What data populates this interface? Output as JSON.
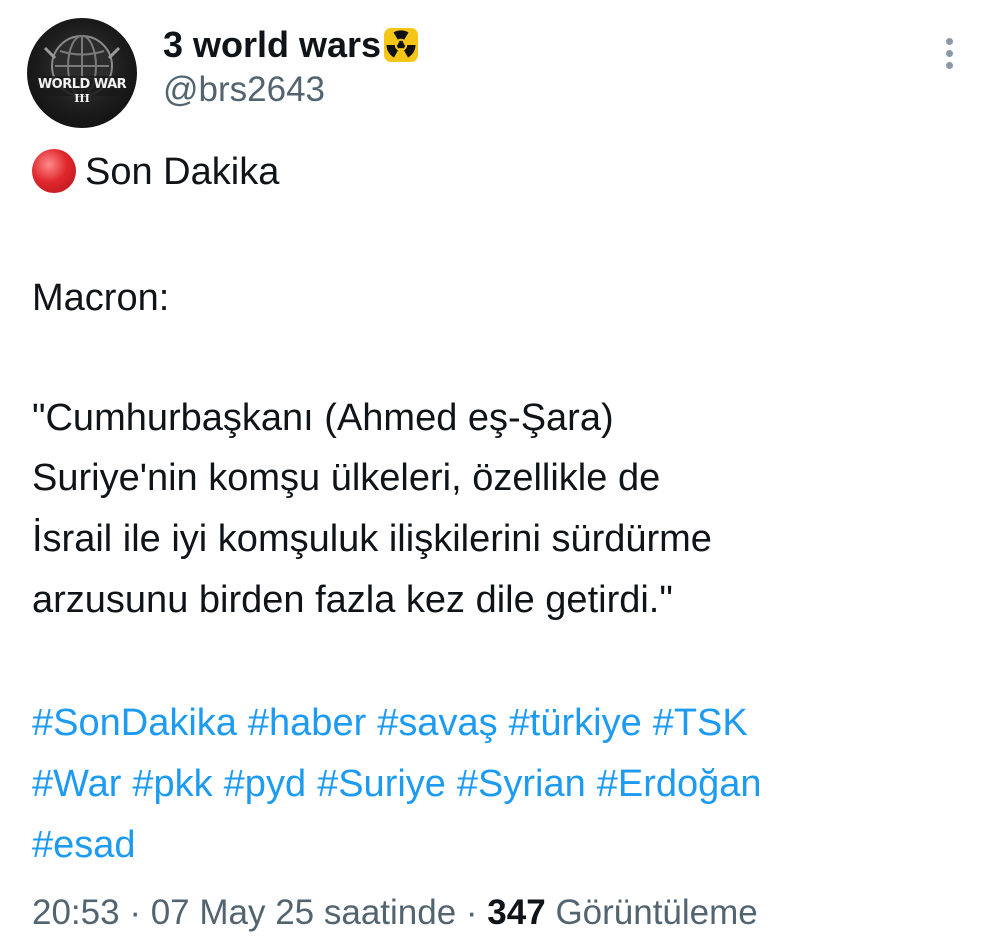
{
  "header": {
    "display_name": "3 world wars",
    "name_emoji_icon": "radioactive-icon",
    "handle": "@brs2643",
    "avatar": {
      "line1": "WORLD WAR",
      "line2": "III"
    },
    "more_icon": "more-vertical-icon"
  },
  "body": {
    "line1_icon": "red-circle-icon",
    "line1": "Son Dakika",
    "line2": "Macron:",
    "quote_lines": [
      "\"Cumhurbaşkanı (Ahmed eş-Şara)",
      "Suriye'nin komşu ülkeleri, özellikle de",
      "İsrail ile iyi komşuluk ilişkilerini sürdürme",
      "arzusunu birden fazla kez dile getirdi.\""
    ]
  },
  "hashtags": [
    "#SonDakika",
    "#haber",
    "#savaş",
    "#türkiye",
    "#TSK",
    "#War",
    "#pkk",
    "#pyd",
    "#Suriye",
    "#Syrian",
    "#Erdoğan",
    "#esad"
  ],
  "meta": {
    "time": "20:53",
    "separator": " · ",
    "date_text": "07 May 25 saatinde",
    "views_count": "347",
    "views_label": "Görüntüleme"
  },
  "colors": {
    "hashtag": "#1d9bf0",
    "secondary_text": "#536471",
    "primary_text": "#0f1419",
    "red_dot": "#e0282e",
    "radioactive_bg": "#f5c518"
  }
}
